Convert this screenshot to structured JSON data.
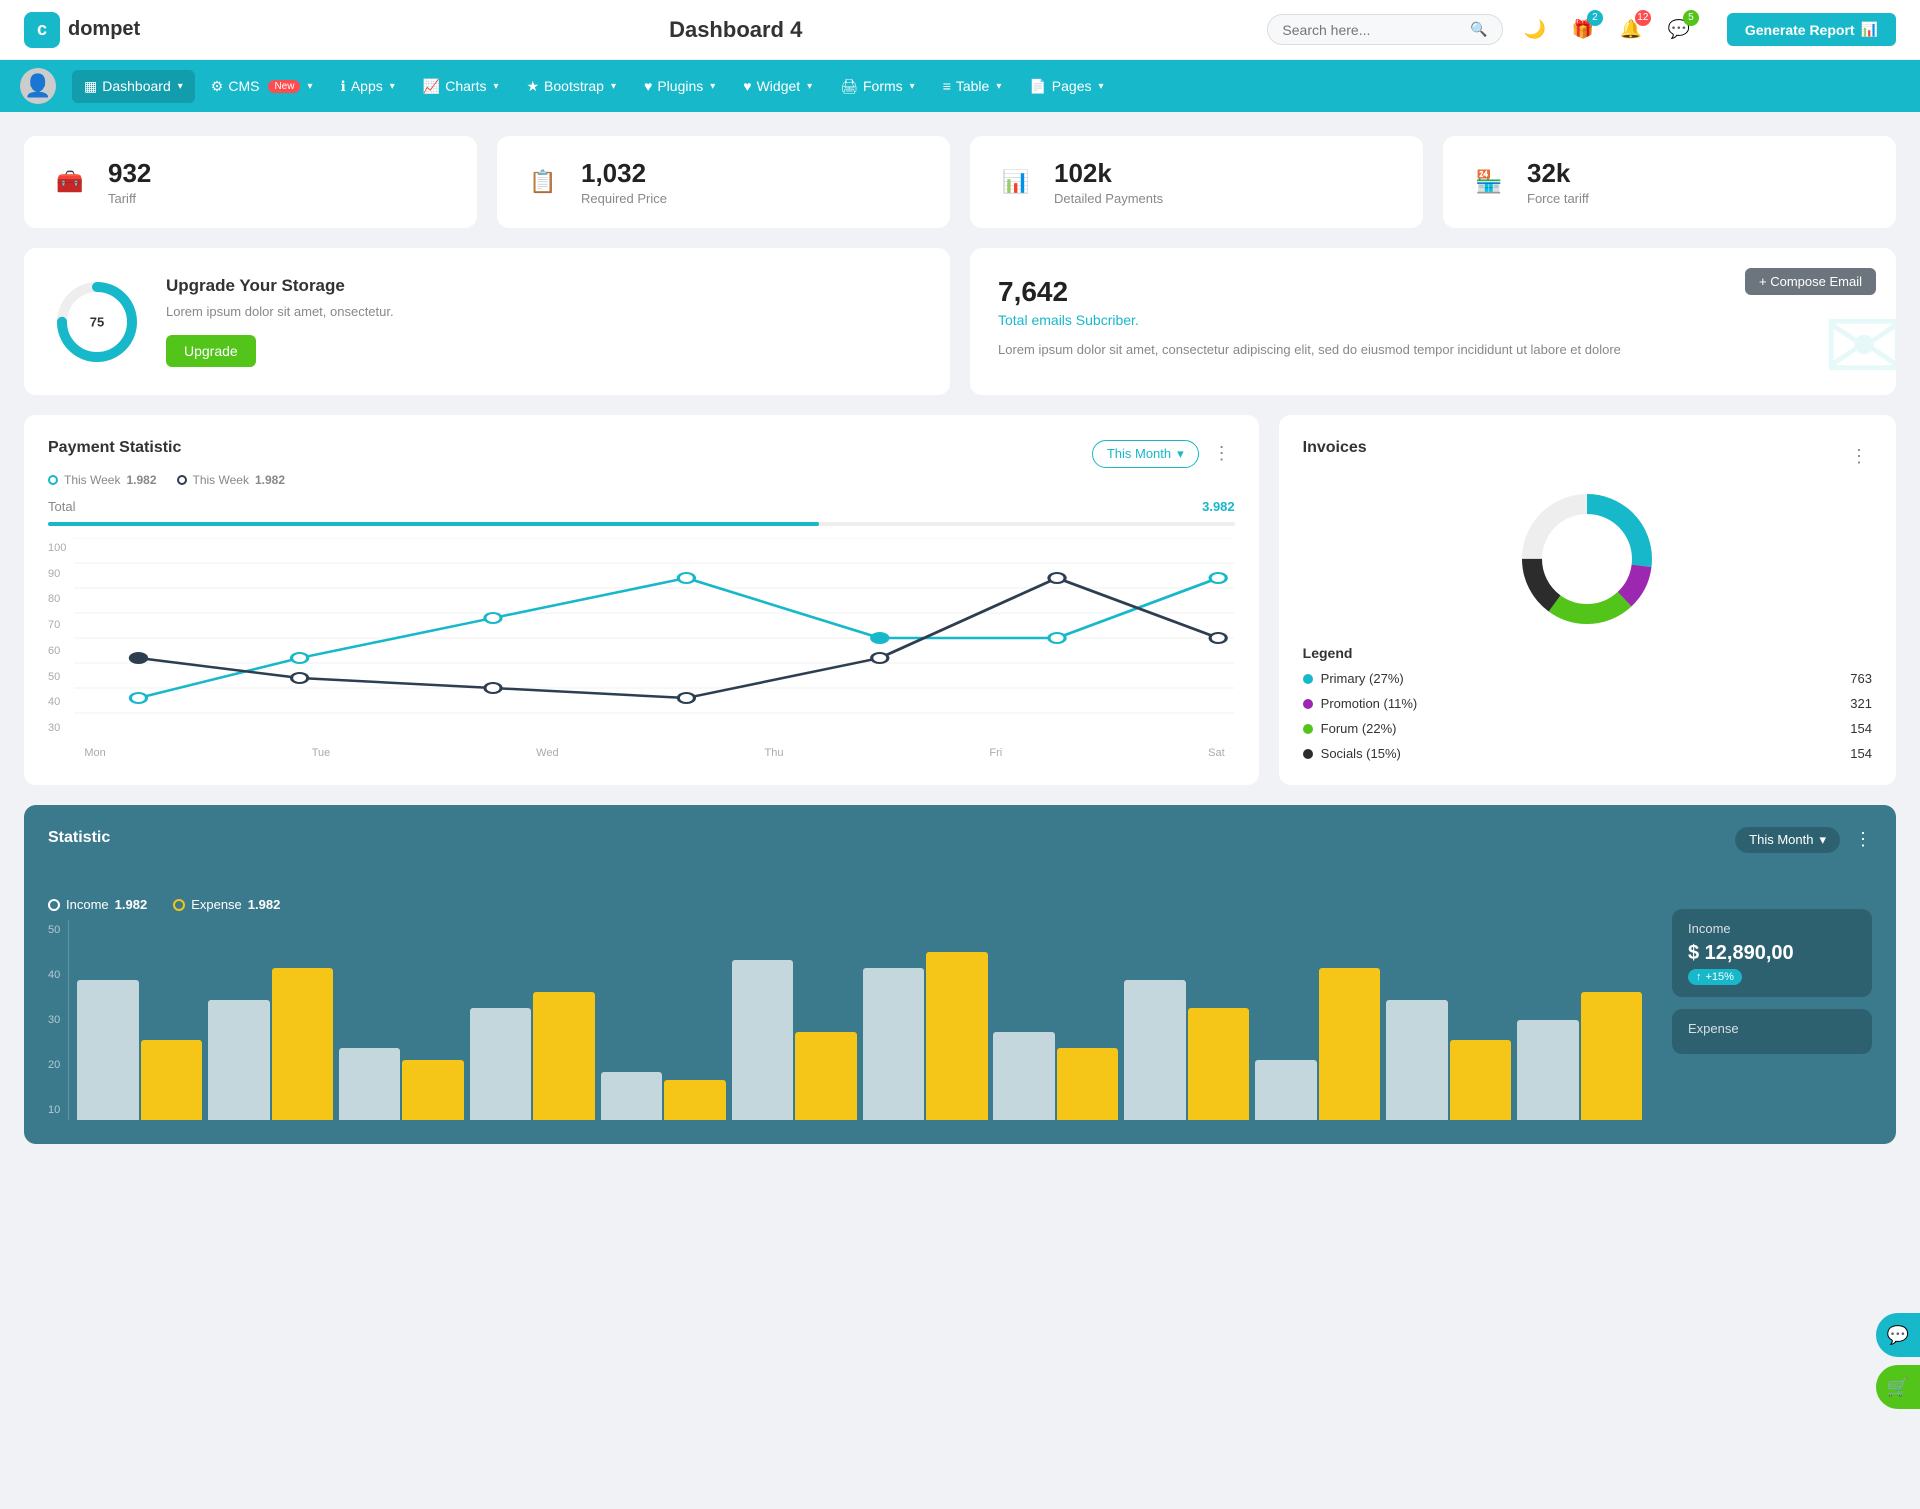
{
  "topbar": {
    "logo_text": "dompet",
    "page_title": "Dashboard 4",
    "search_placeholder": "Search here...",
    "icons": {
      "moon": "🌙",
      "gift_badge": "2",
      "bell_badge": "12",
      "chat_badge": "5"
    },
    "generate_btn": "Generate Report"
  },
  "navbar": {
    "items": [
      {
        "id": "dashboard",
        "label": "Dashboard",
        "icon": "▦",
        "active": true,
        "has_dropdown": true
      },
      {
        "id": "cms",
        "label": "CMS",
        "icon": "⚙",
        "badge": "New",
        "has_dropdown": true
      },
      {
        "id": "apps",
        "label": "Apps",
        "icon": "ℹ",
        "has_dropdown": true
      },
      {
        "id": "charts",
        "label": "Charts",
        "icon": "📈",
        "has_dropdown": true
      },
      {
        "id": "bootstrap",
        "label": "Bootstrap",
        "icon": "★",
        "has_dropdown": true
      },
      {
        "id": "plugins",
        "label": "Plugins",
        "icon": "♥",
        "has_dropdown": true
      },
      {
        "id": "widget",
        "label": "Widget",
        "icon": "♥",
        "has_dropdown": true
      },
      {
        "id": "forms",
        "label": "Forms",
        "icon": "🖨",
        "has_dropdown": true
      },
      {
        "id": "table",
        "label": "Table",
        "icon": "≡",
        "has_dropdown": true
      },
      {
        "id": "pages",
        "label": "Pages",
        "icon": "📄",
        "has_dropdown": true
      }
    ]
  },
  "stat_cards": [
    {
      "id": "tariff",
      "number": "932",
      "label": "Tariff",
      "icon": "🧰",
      "icon_color": "#17b8c9"
    },
    {
      "id": "required_price",
      "number": "1,032",
      "label": "Required Price",
      "icon": "📋",
      "icon_color": "#ff4d4f"
    },
    {
      "id": "detailed_payments",
      "number": "102k",
      "label": "Detailed Payments",
      "icon": "📊",
      "icon_color": "#9c27b0"
    },
    {
      "id": "force_tariff",
      "number": "32k",
      "label": "Force tariff",
      "icon": "🏪",
      "icon_color": "#e91e8c"
    }
  ],
  "storage": {
    "title": "Upgrade Your Storage",
    "desc": "Lorem ipsum dolor sit amet, onsectetur.",
    "percent": 75,
    "btn_label": "Upgrade"
  },
  "email": {
    "number": "7,642",
    "subtitle": "Total emails Subcriber.",
    "desc": "Lorem ipsum dolor sit amet, consectetur adipiscing elit, sed do eiusmod tempor incididunt ut labore et dolore",
    "compose_btn": "+ Compose Email"
  },
  "payment": {
    "title": "Payment Statistic",
    "legend1_label": "This Week",
    "legend1_value": "1.982",
    "legend2_label": "This Week",
    "legend2_value": "1.982",
    "filter_label": "This Month",
    "total_label": "Total",
    "total_value": "3.982",
    "progress_percent": 65,
    "x_labels": [
      "Mon",
      "Tue",
      "Wed",
      "Thu",
      "Fri",
      "Sat"
    ],
    "y_labels": [
      "100",
      "90",
      "80",
      "70",
      "60",
      "50",
      "40",
      "30"
    ],
    "line1_points": "40,160 100,155 200,120 310,80 415,120 510,120 600,100 700,100",
    "line2_points": "40,120 100,140 200,150 310,40 415,120 510,125 600,40 700,40"
  },
  "invoices": {
    "title": "Invoices",
    "legend": [
      {
        "label": "Primary (27%)",
        "value": "763",
        "color": "#17b8c9"
      },
      {
        "label": "Promotion (11%)",
        "value": "321",
        "color": "#9c27b0"
      },
      {
        "label": "Forum (22%)",
        "value": "154",
        "color": "#52c41a"
      },
      {
        "label": "Socials (15%)",
        "value": "154",
        "color": "#333"
      }
    ],
    "donut": {
      "segments": [
        {
          "label": "Primary",
          "percent": 27,
          "color": "#17b8c9"
        },
        {
          "label": "Promotion",
          "percent": 11,
          "color": "#9c27b0"
        },
        {
          "label": "Forum",
          "percent": 22,
          "color": "#52c41a"
        },
        {
          "label": "Socials",
          "percent": 15,
          "color": "#333"
        },
        {
          "label": "Rest",
          "percent": 25,
          "color": "#eee"
        }
      ]
    }
  },
  "statistic": {
    "title": "Statistic",
    "filter_label": "This Month",
    "income_label": "Income",
    "income_value": "1.982",
    "expense_label": "Expense",
    "expense_value": "1.982",
    "income_detail_label": "Income",
    "income_amount": "$ 12,890,00",
    "income_badge": "+15%",
    "expense_detail_label": "Expense",
    "y_labels": [
      "50",
      "40",
      "30",
      "20",
      "10"
    ],
    "bars": [
      {
        "white": 35,
        "yellow": 20
      },
      {
        "white": 30,
        "yellow": 38
      },
      {
        "white": 18,
        "yellow": 15
      },
      {
        "white": 28,
        "yellow": 32
      },
      {
        "white": 12,
        "yellow": 10
      },
      {
        "white": 40,
        "yellow": 22
      },
      {
        "white": 38,
        "yellow": 42
      },
      {
        "white": 22,
        "yellow": 18
      },
      {
        "white": 35,
        "yellow": 28
      },
      {
        "white": 15,
        "yellow": 38
      },
      {
        "white": 30,
        "yellow": 20
      },
      {
        "white": 25,
        "yellow": 32
      }
    ]
  },
  "floating": {
    "support_icon": "💬",
    "cart_icon": "🛒"
  }
}
